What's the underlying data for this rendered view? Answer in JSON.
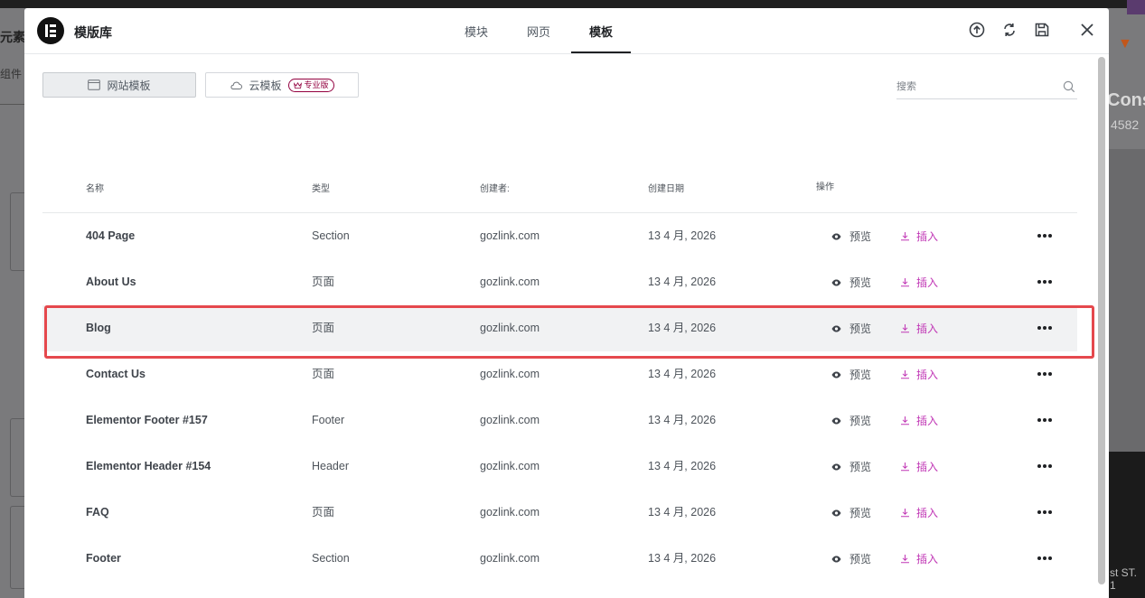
{
  "background": {
    "left_text_1": "元素",
    "left_text_2": "组件",
    "right_text_1": "Cons",
    "right_text_2": "4582",
    "right_text_3": "st ST. 1"
  },
  "modal": {
    "title": "模版库",
    "tabs": [
      {
        "label": "模块",
        "active": false
      },
      {
        "label": "网页",
        "active": false
      },
      {
        "label": "模板",
        "active": true
      }
    ],
    "header_icons": [
      "upload-icon",
      "sync-icon",
      "save-icon",
      "close-icon"
    ]
  },
  "toolbar": {
    "site_templates_label": "网站模板",
    "cloud_templates_label": "云模板",
    "pro_badge": "专业版",
    "search_placeholder": "搜索"
  },
  "table": {
    "headers": {
      "name": "名称",
      "type": "类型",
      "author": "创建者:",
      "date": "创建日期",
      "actions": "操作"
    },
    "preview_label": "预览",
    "insert_label": "插入",
    "rows": [
      {
        "name": "404 Page",
        "type": "Section",
        "author": "gozlink.com",
        "date": "13 4 月, 2026"
      },
      {
        "name": "About Us",
        "type": "页面",
        "author": "gozlink.com",
        "date": "13 4 月, 2026"
      },
      {
        "name": "Blog",
        "type": "页面",
        "author": "gozlink.com",
        "date": "13 4 月, 2026",
        "highlighted": true
      },
      {
        "name": "Contact Us",
        "type": "页面",
        "author": "gozlink.com",
        "date": "13 4 月, 2026"
      },
      {
        "name": "Elementor Footer #157",
        "type": "Footer",
        "author": "gozlink.com",
        "date": "13 4 月, 2026"
      },
      {
        "name": "Elementor Header #154",
        "type": "Header",
        "author": "gozlink.com",
        "date": "13 4 月, 2026"
      },
      {
        "name": "FAQ",
        "type": "页面",
        "author": "gozlink.com",
        "date": "13 4 月, 2026"
      },
      {
        "name": "Footer",
        "type": "Section",
        "author": "gozlink.com",
        "date": "13 4 月, 2026"
      }
    ]
  },
  "colors": {
    "accent_insert": "#c036b5",
    "highlight_box": "#e5484d",
    "pro_badge": "#93003f"
  }
}
